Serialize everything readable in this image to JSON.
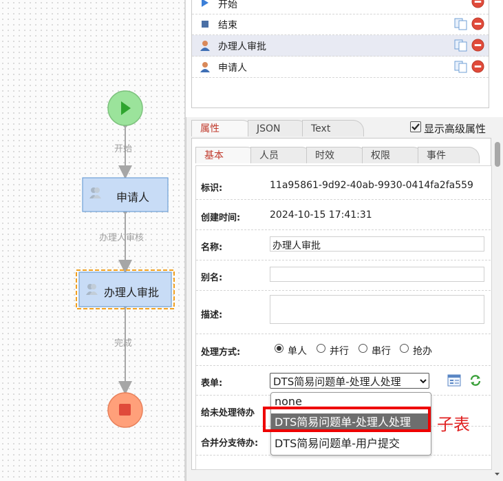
{
  "flow": {
    "start_edge_label": "开始",
    "node_applicant": "申请人",
    "edge_review_label": "办理人审核",
    "node_handler_approval": "办理人审批",
    "done_edge_label": "完成"
  },
  "node_list": {
    "items": [
      {
        "label": "开始",
        "icon": "play-icon"
      },
      {
        "label": "结束",
        "icon": "stop-square-icon"
      },
      {
        "label": "办理人审批",
        "icon": "user-icon",
        "selected": true
      },
      {
        "label": "申请人",
        "icon": "user-icon"
      }
    ]
  },
  "panel": {
    "tabs": [
      "属性",
      "JSON",
      "Text"
    ],
    "active_tab": "属性",
    "show_advanced_label": "显示高级属性",
    "show_advanced_checked": true,
    "subtabs": [
      "基本",
      "人员",
      "时效",
      "权限",
      "事件"
    ],
    "active_subtab": "基本"
  },
  "form": {
    "id_label": "标识:",
    "id_value": "11a95861-9d92-40ab-9930-0414fa2fa559",
    "created_label": "创建时间:",
    "created_value": "2024-10-15 17:41:31",
    "name_label": "名称:",
    "name_value": "办理人审批",
    "alias_label": "别名:",
    "alias_value": "",
    "desc_label": "描述:",
    "desc_value": "",
    "mode_label": "处理方式:",
    "mode_options": [
      "单人",
      "并行",
      "串行",
      "抢办"
    ],
    "mode_selected": "单人",
    "form_label": "表单:",
    "form_selected": "DTS简易问题单-处理人处理",
    "form_options": [
      "none",
      "DTS简易问题单-处理人处理",
      "DTS简易问题单-用户提交"
    ],
    "pending_label": "给未处理待办",
    "merge_label": "合并分支待办:"
  },
  "annotation": "子表",
  "colors": {
    "accent_tab": "#c0392b",
    "annotation_red": "#ee0000",
    "start_green": "#9be39b",
    "end_orange": "#ffa07a",
    "node_blue": "#c8dcf6"
  }
}
